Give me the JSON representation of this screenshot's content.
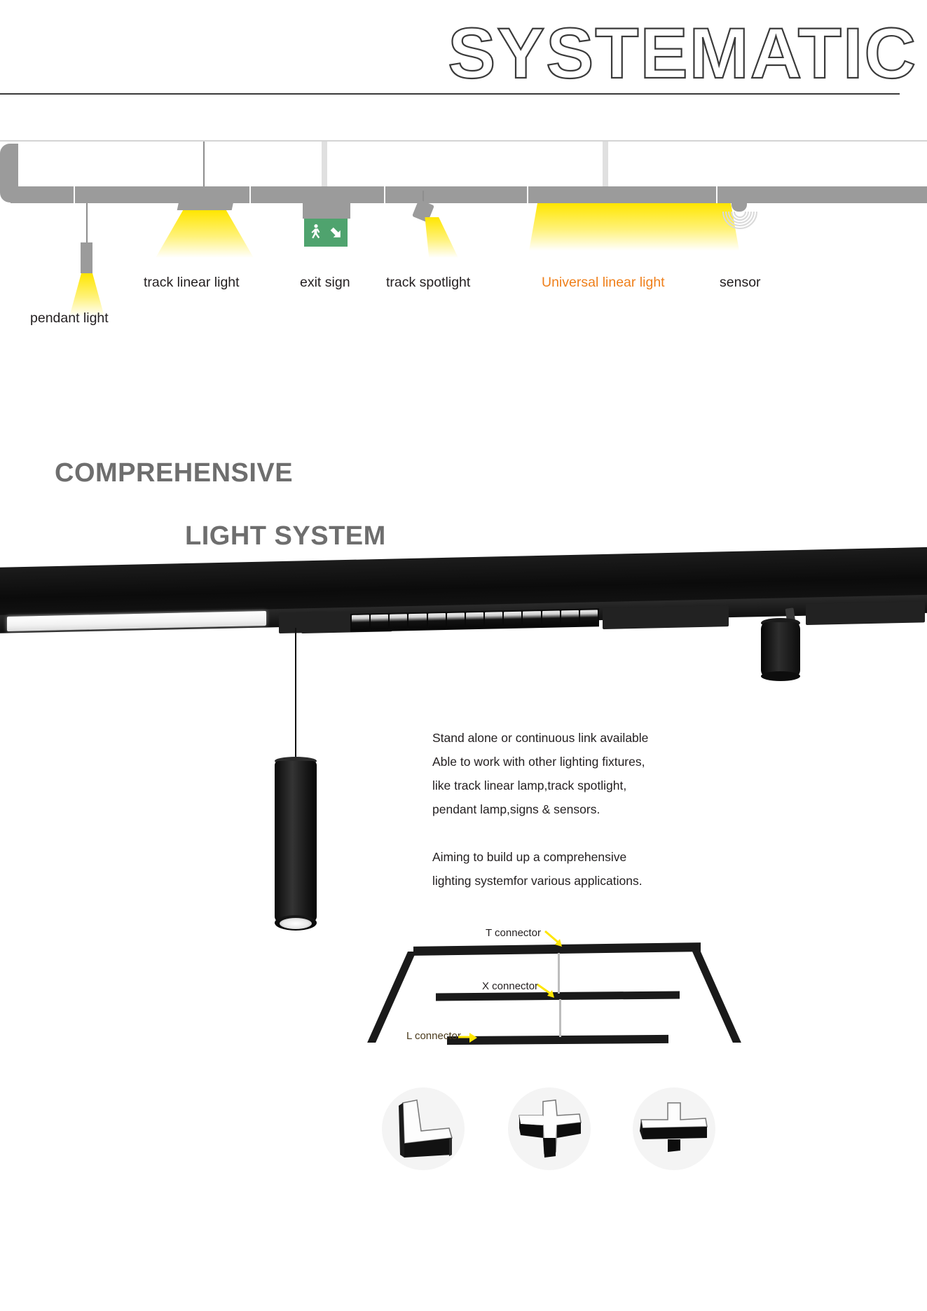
{
  "header": {
    "title": "SYSTEMATIC"
  },
  "schematic": {
    "labels": [
      {
        "text": "pendant light",
        "accent": false
      },
      {
        "text": "track linear light",
        "accent": false
      },
      {
        "text": "exit sign",
        "accent": false
      },
      {
        "text": "track spotlight",
        "accent": false
      },
      {
        "text": "Universal linear light",
        "accent": true
      },
      {
        "text": "sensor",
        "accent": false
      }
    ],
    "icons": [
      "pendant-light-icon",
      "track-linear-light-icon",
      "exit-sign-icon",
      "track-spotlight-icon",
      "universal-linear-light-icon",
      "sensor-icon"
    ]
  },
  "headline": {
    "line1": "COMPREHENSIVE",
    "line2": "LIGHT SYSTEM"
  },
  "copy": {
    "paragraph1": [
      "Stand alone or continuous link available",
      "Able to work with other lighting fixtures,",
      "like track linear lamp,track spotlight,",
      "pendant lamp,signs & sensors."
    ],
    "paragraph2": [
      "Aiming to build up a comprehensive",
      "lighting systemfor various applications."
    ]
  },
  "diagram": {
    "labels": [
      {
        "text": "T connector",
        "name": "t-connector-label"
      },
      {
        "text": "X connector",
        "name": "x-connector-label"
      },
      {
        "text": "L connector",
        "name": "l-connector-label"
      }
    ]
  },
  "connectors": [
    {
      "name": "l-connector-icon"
    },
    {
      "name": "x-connector-icon"
    },
    {
      "name": "t-connector-icon"
    }
  ],
  "colors": {
    "accent_orange": "#EF7F1A",
    "headline_gray": "#6E6E6E",
    "rail_gray": "#9B9B9B",
    "beam_yellow": "#FFE600",
    "exit_green": "#4FA36E",
    "body_black": "#231F20",
    "product_black": "#0B0B0B"
  }
}
